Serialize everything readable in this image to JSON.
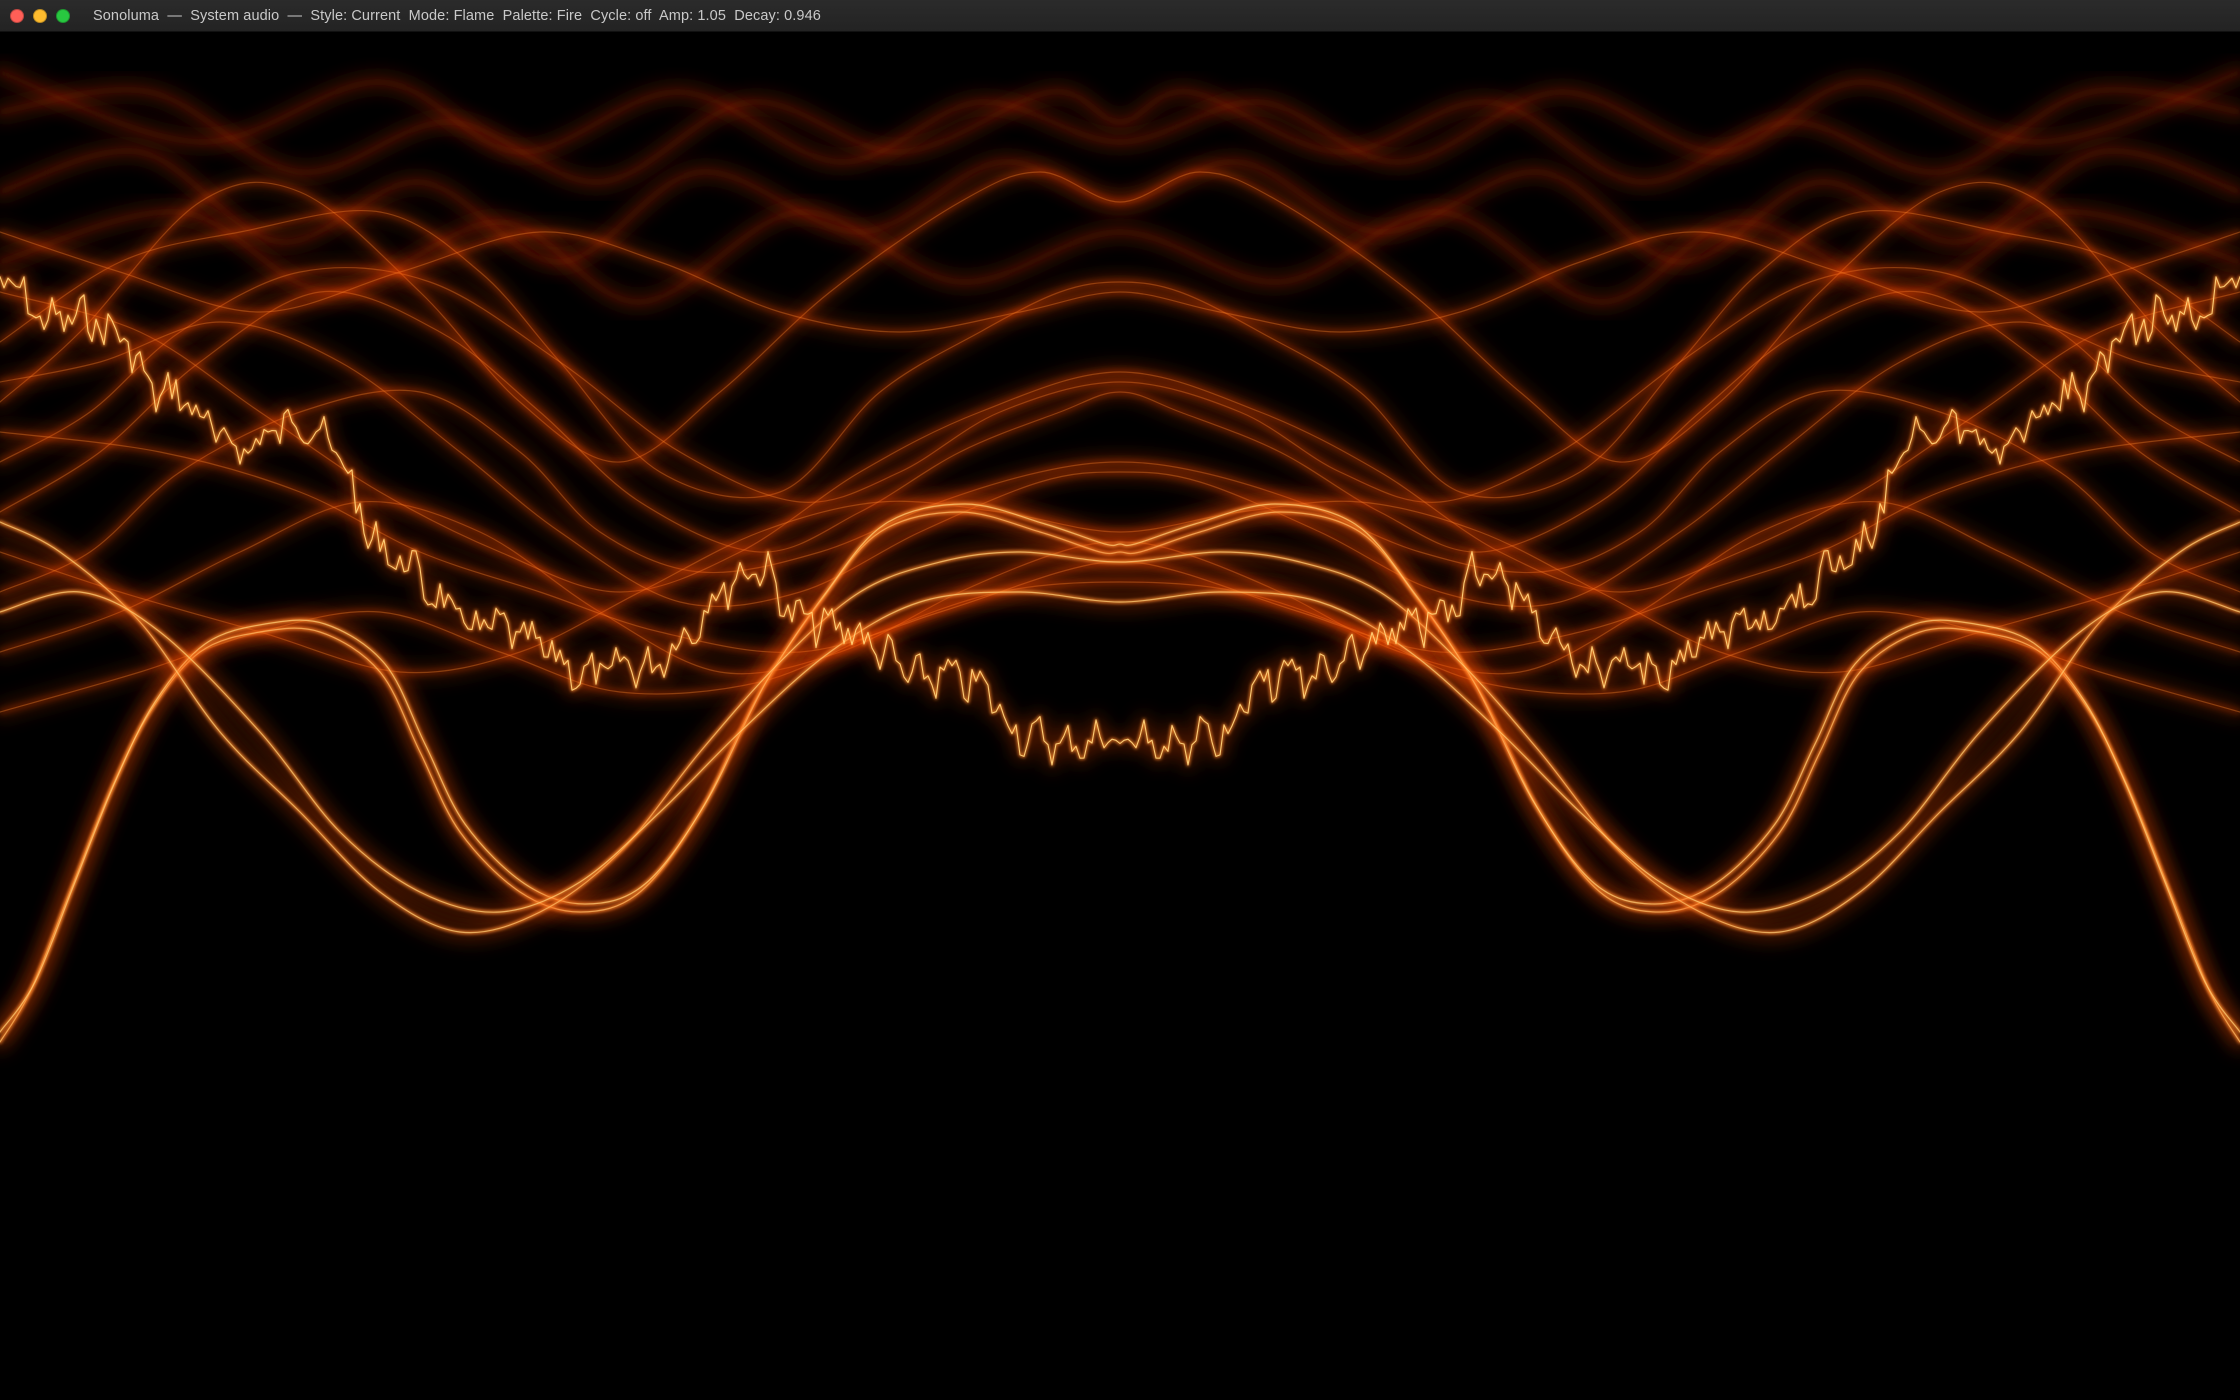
{
  "window": {
    "title": "Sonoluma  —  System audio  —  Style: Current  Mode: Flame  Palette: Fire  Cycle: off  Amp: 1.05  Decay: 0.946",
    "traffic_lights": {
      "close": {
        "icon": "close-icon",
        "color": "#ff5f57"
      },
      "minimize": {
        "icon": "minimize-icon",
        "color": "#febc2e"
      },
      "zoom": {
        "icon": "zoom-icon",
        "color": "#28c840"
      }
    }
  },
  "visualizer": {
    "source": "System audio",
    "style": "Current",
    "mode": "Flame",
    "palette": "Fire",
    "cycle": "off",
    "amp": 1.05,
    "decay": 0.946,
    "colors": {
      "background": "#000000",
      "trail": "#ff4a0a",
      "trail_dim": "#a82a08",
      "core": "#ffd27a",
      "hot": "#ff8a2a"
    }
  }
}
